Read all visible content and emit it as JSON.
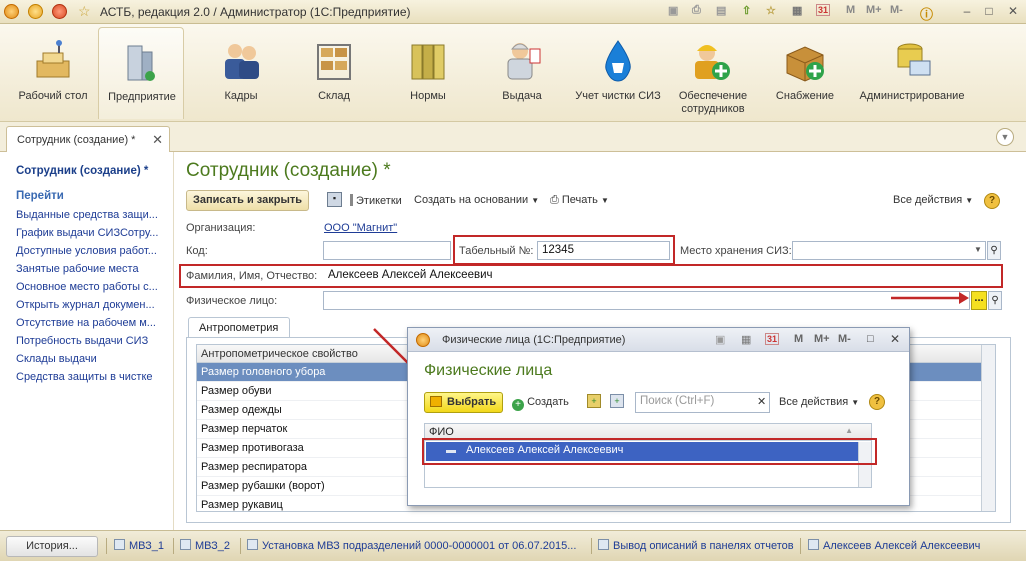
{
  "window": {
    "title": "АСТБ, редакция 2.0 / Администратор  (1С:Предприятие)",
    "toolbar_m": "M",
    "toolbar_mplus": "M+",
    "toolbar_mminus": "M-",
    "calendar_day": "31"
  },
  "sections": [
    {
      "label": "Рабочий стол",
      "icon": "desktop-icon"
    },
    {
      "label": "Предприятие",
      "icon": "enterprise-icon"
    },
    {
      "label": "Кадры",
      "icon": "staff-icon"
    },
    {
      "label": "Склад",
      "icon": "warehouse-icon"
    },
    {
      "label": "Нормы",
      "icon": "norms-icon"
    },
    {
      "label": "Выдача",
      "icon": "issue-icon"
    },
    {
      "label": "Учет чистки СИЗ",
      "icon": "cleaning-icon"
    },
    {
      "label": "Обеспечение сотрудников",
      "icon": "provision-icon"
    },
    {
      "label": "Снабжение",
      "icon": "supply-icon"
    },
    {
      "label": "Администрирование",
      "icon": "admin-icon"
    }
  ],
  "doc_tab": {
    "label": "Сотрудник (создание) *"
  },
  "nav": {
    "title": "Сотрудник (создание) *",
    "goto": "Перейти",
    "links": [
      "Выданные средства защи...",
      "График выдачи СИЗСотру...",
      "Доступные условия работ...",
      "Занятые рабочие места",
      "Основное место работы с...",
      "Открыть журнал докумен...",
      "Отсутствие на рабочем м...",
      "Потребность выдачи СИЗ",
      "Склады выдачи",
      "Средства защиты в чистке"
    ]
  },
  "form": {
    "title": "Сотрудник (создание) *",
    "btn_save_close": "Записать и закрыть",
    "btn_labels": "Этикетки",
    "btn_create_based": "Создать на основании",
    "btn_print": "Печать",
    "btn_all_actions": "Все действия",
    "org_label": "Организация:",
    "org_value": "ООО \"Магнит\"",
    "code_label": "Код:",
    "code_value": "",
    "tab_num_label": "Табельный №:",
    "tab_num_value": "12345",
    "storage_label": "Место хранения СИЗ:",
    "storage_value": "",
    "fio_label": "Фамилия, Имя, Отчество:",
    "fio_value": "Алексеев Алексей Алексеевич",
    "person_label": "Физическое лицо:",
    "person_value": "",
    "select_dots": "...",
    "ant_tab": "Антропометрия",
    "ant_header": "Антропометрическое свойство",
    "ant_rows": [
      "Размер головного убора",
      "Размер обуви",
      "Размер одежды",
      "Размер перчаток",
      "Размер противогаза",
      "Размер респиратора",
      "Размер рубашки (ворот)",
      "Размер рукавиц"
    ]
  },
  "popup": {
    "title": "Физические лица  (1С:Предприятие)",
    "heading": "Физические лица",
    "btn_select": "Выбрать",
    "btn_create": "Создать",
    "search_placeholder": "Поиск (Ctrl+F)",
    "btn_all_actions": "Все действия",
    "grid_header": "ФИО",
    "row": "Алексеев Алексей Алексеевич",
    "m": "M",
    "mplus": "M+",
    "mminus": "M-",
    "cal": "31"
  },
  "taskbar": {
    "history": "История...",
    "items": [
      "МВЗ_1",
      "МВЗ_2",
      "Установка МВЗ подразделений 0000-0000001 от 06.07.2015...",
      "Вывод описаний в панелях отчетов",
      "Алексеев Алексей Алексеевич"
    ]
  },
  "colors": {
    "accent_green": "#4c7a1e",
    "link_blue": "#1e3c96",
    "highlight_red": "#c22828",
    "selection_blue": "#3d63c2"
  }
}
